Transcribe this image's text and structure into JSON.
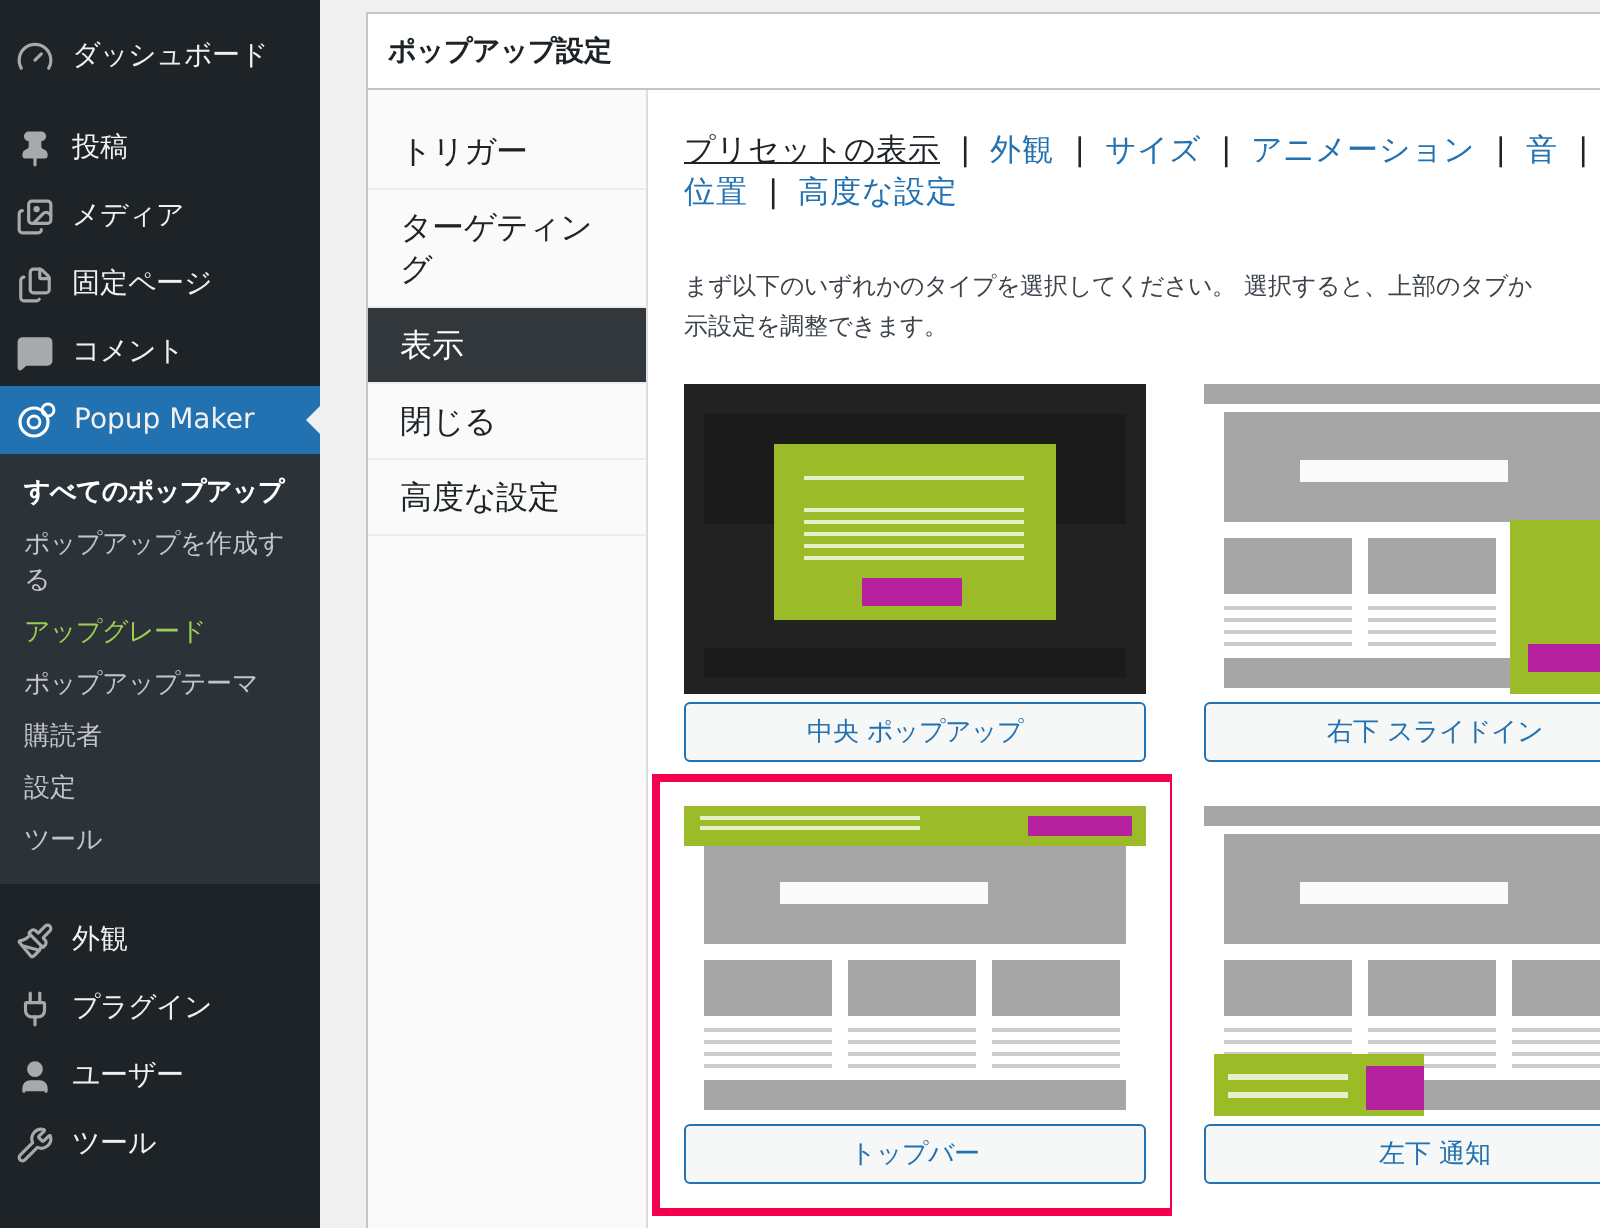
{
  "sidebar": {
    "items": [
      {
        "kind": "dashboard",
        "label": "ダッシュボード",
        "selected": false
      },
      {
        "kind": "pin",
        "label": "投稿",
        "selected": false
      },
      {
        "kind": "media",
        "label": "メディア",
        "selected": false
      },
      {
        "kind": "pages",
        "label": "固定ページ",
        "selected": false
      },
      {
        "kind": "comment",
        "label": "コメント",
        "selected": false
      },
      {
        "kind": "popup",
        "label": "Popup Maker",
        "selected": true,
        "children": [
          {
            "label": "すべてのポップアップ",
            "selected": true,
            "kind": "link"
          },
          {
            "label": "ポップアップを作成する",
            "selected": false,
            "kind": "link"
          },
          {
            "label": "アップグレード",
            "selected": false,
            "kind": "upgrade"
          },
          {
            "label": "ポップアップテーマ",
            "selected": false,
            "kind": "link"
          },
          {
            "label": "購読者",
            "selected": false,
            "kind": "link"
          },
          {
            "label": "設定",
            "selected": false,
            "kind": "link"
          },
          {
            "label": "ツール",
            "selected": false,
            "kind": "link"
          }
        ]
      },
      {
        "kind": "appearance",
        "label": "外観",
        "selected": false
      },
      {
        "kind": "plugin",
        "label": "プラグイン",
        "selected": false
      },
      {
        "kind": "user",
        "label": "ユーザー",
        "selected": false
      },
      {
        "kind": "tool",
        "label": "ツール",
        "selected": false
      }
    ]
  },
  "metabox": {
    "title": "ポップアップ設定",
    "tabs": [
      {
        "label": "トリガー",
        "selected": false
      },
      {
        "label": "ターゲティング",
        "selected": false
      },
      {
        "label": "表示",
        "selected": true
      },
      {
        "label": "閉じる",
        "selected": false
      },
      {
        "label": "高度な設定",
        "selected": false
      }
    ],
    "subnav": {
      "separator": "|",
      "links": [
        {
          "label": "プリセットの表示",
          "selected": true
        },
        {
          "label": "外観",
          "selected": false
        },
        {
          "label": "サイズ",
          "selected": false
        },
        {
          "label": "アニメーション",
          "selected": false
        },
        {
          "label": "音",
          "selected": false
        },
        {
          "label": "位置",
          "selected": false
        },
        {
          "label": "高度な設定",
          "selected": false
        }
      ]
    },
    "description": [
      "まず以下のいずれかのタイプを選択してください。 選択すると、上部のタブか",
      "示設定を調整できます。"
    ],
    "presets": [
      {
        "kind": "center",
        "label": "中央 ポップアップ",
        "selected": false
      },
      {
        "kind": "slidein",
        "label": "右下 スライドイン",
        "selected": false
      },
      {
        "kind": "topbar",
        "label": "トップバー",
        "selected": true
      },
      {
        "kind": "notice",
        "label": "左下 通知",
        "selected": false
      }
    ]
  }
}
